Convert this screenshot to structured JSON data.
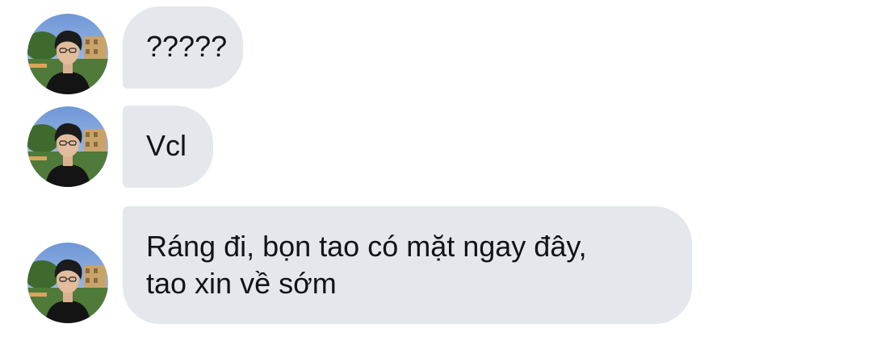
{
  "chat": {
    "messages": [
      {
        "sender_avatar": "person-photo-avatar",
        "lines": [
          "?????"
        ]
      },
      {
        "sender_avatar": "person-photo-avatar",
        "lines": [
          "Vcl"
        ]
      },
      {
        "sender_avatar": "person-photo-avatar",
        "lines": [
          "Ráng đi, bọn tao có mặt ngay đây,",
          "tao xin về sớm"
        ]
      }
    ]
  },
  "colors": {
    "bubble_background": "#e4e8ed",
    "message_text": "#111316",
    "page_background": "#ffffff"
  }
}
